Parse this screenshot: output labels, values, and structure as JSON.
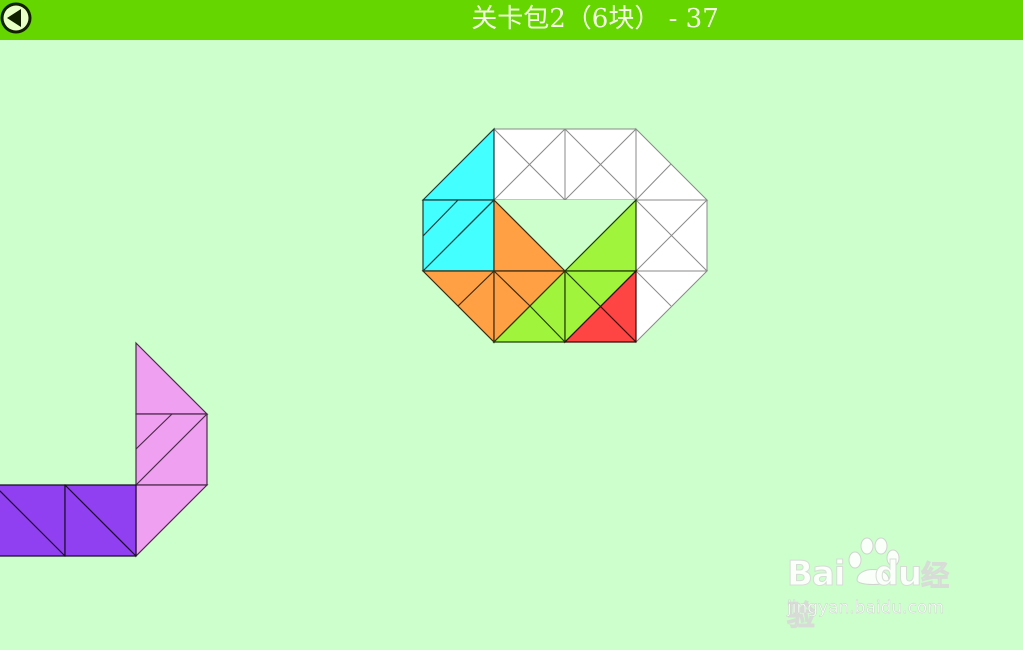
{
  "header": {
    "title": "关卡包2（6块） - 37",
    "back_icon": "back-arrow-icon"
  },
  "colors": {
    "background": "#ccffcc",
    "header_bar": "#66d600",
    "target_outline": "#ffffff",
    "piece_cyan": "#44ffff",
    "piece_orange": "#ffa044",
    "piece_green": "#a0f53c",
    "piece_red": "#ff4444",
    "piece_pink": "#f0a0f0",
    "piece_purple": "#9040f0"
  },
  "pieces": [
    {
      "name": "cyan",
      "placed": true
    },
    {
      "name": "orange",
      "placed": true
    },
    {
      "name": "green",
      "placed": true
    },
    {
      "name": "red",
      "placed": true
    },
    {
      "name": "pink",
      "placed": false
    },
    {
      "name": "purple",
      "placed": false
    }
  ],
  "watermark": {
    "brand": "Bai",
    "brand2": "du",
    "product": "经验",
    "url": "jingyan.baidu.com"
  }
}
